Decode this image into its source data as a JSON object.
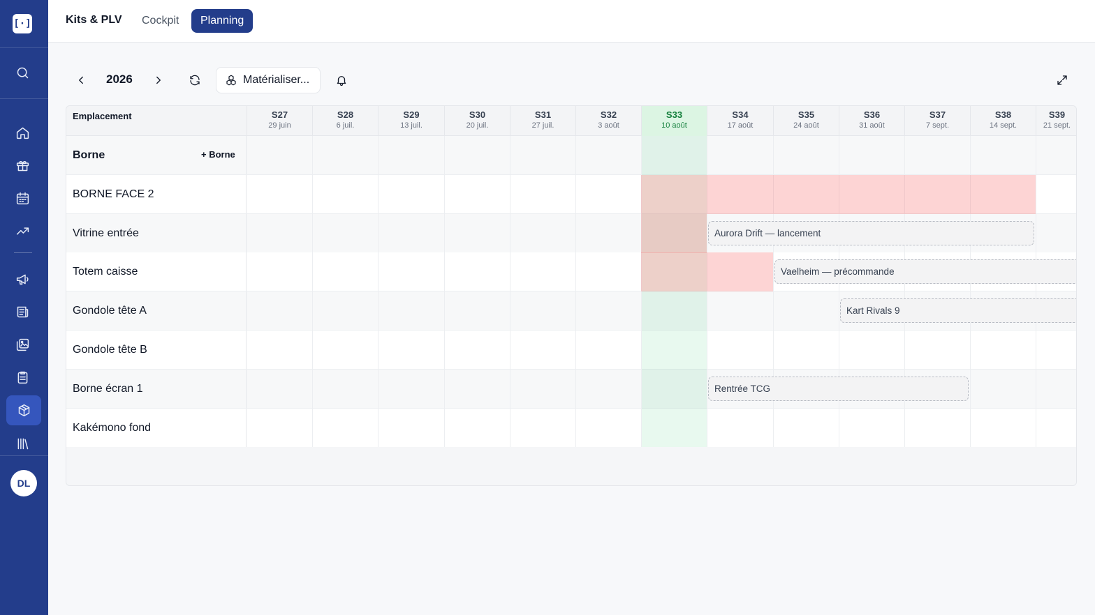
{
  "sidebar": {
    "logo": "[·]",
    "items": [
      {
        "icon": "search-icon"
      },
      {
        "icon": "home-icon"
      },
      {
        "icon": "gift-icon"
      },
      {
        "icon": "calendar-icon"
      },
      {
        "icon": "trending-up-icon"
      },
      {
        "icon": "megaphone-icon"
      },
      {
        "icon": "newspaper-icon"
      },
      {
        "icon": "images-icon"
      },
      {
        "icon": "clipboard-icon"
      },
      {
        "icon": "package-icon",
        "active": true
      },
      {
        "icon": "library-icon"
      }
    ],
    "avatar_initials": "DL"
  },
  "header": {
    "title": "Kits & PLV",
    "tabs": [
      {
        "label": "Cockpit",
        "active": false
      },
      {
        "label": "Planning",
        "active": true
      }
    ]
  },
  "toolbar": {
    "year": "2026",
    "materialize_label": "Matérialiser..."
  },
  "planning": {
    "column_header": "Emplacement",
    "weeks": [
      {
        "num": "S27",
        "date": "29 juin"
      },
      {
        "num": "S28",
        "date": "6 juil."
      },
      {
        "num": "S29",
        "date": "13 juil."
      },
      {
        "num": "S30",
        "date": "20 juil."
      },
      {
        "num": "S31",
        "date": "27 juil."
      },
      {
        "num": "S32",
        "date": "3 août"
      },
      {
        "num": "S33",
        "date": "10 août",
        "current": true
      },
      {
        "num": "S34",
        "date": "17 août"
      },
      {
        "num": "S35",
        "date": "24 août"
      },
      {
        "num": "S36",
        "date": "31 août"
      },
      {
        "num": "S37",
        "date": "7 sept."
      },
      {
        "num": "S38",
        "date": "14 sept."
      },
      {
        "num": "S39",
        "date": "21 sept."
      }
    ],
    "rows": [
      {
        "label": "Borne",
        "group": true,
        "add_label": "+ Borne"
      },
      {
        "label": "BORNE FACE 2"
      },
      {
        "label": "Vitrine entrée"
      },
      {
        "label": "Totem caisse"
      },
      {
        "label": "Gondole tête A"
      },
      {
        "label": "Gondole tête B"
      },
      {
        "label": "Borne écran 1"
      },
      {
        "label": "Kakémono fond"
      }
    ],
    "occupied": [
      {
        "row": 1,
        "from": "S33",
        "to": "S38"
      },
      {
        "row": 2,
        "from": "S33",
        "to": "S33"
      },
      {
        "row": 3,
        "from": "S33",
        "to": "S34"
      }
    ],
    "campaigns": [
      {
        "row": 2,
        "label": "Aurora Drift — lancement",
        "from": "S34",
        "to": "S38"
      },
      {
        "row": 3,
        "label": "Vaelheim — précommande",
        "from": "S35",
        "to": "S39"
      },
      {
        "row": 4,
        "label": "Kart Rivals 9",
        "from": "S36",
        "to": "S39"
      },
      {
        "row": 6,
        "label": "Rentrée TCG",
        "from": "S34",
        "to": "S37"
      }
    ]
  }
}
